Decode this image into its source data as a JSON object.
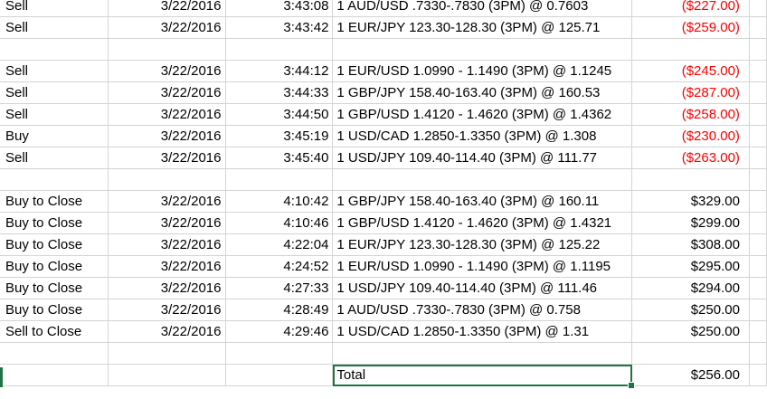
{
  "rows": [
    {
      "action": "Sell",
      "date": "3/22/2016",
      "time": "3:43:08",
      "desc": "1 AUD/USD .7330-.7830 (3PM) @ 0.7603",
      "amount": "($227.00)",
      "neg": true
    },
    {
      "action": "Sell",
      "date": "3/22/2016",
      "time": "3:43:42",
      "desc": "1 EUR/JPY 123.30-128.30 (3PM) @ 125.71",
      "amount": "($259.00)",
      "neg": true
    },
    {
      "action": "",
      "date": "",
      "time": "",
      "desc": "",
      "amount": "",
      "neg": false
    },
    {
      "action": "Sell",
      "date": "3/22/2016",
      "time": "3:44:12",
      "desc": "1 EUR/USD 1.0990 - 1.1490 (3PM) @ 1.1245",
      "amount": "($245.00)",
      "neg": true
    },
    {
      "action": "Sell",
      "date": "3/22/2016",
      "time": "3:44:33",
      "desc": "1 GBP/JPY 158.40-163.40 (3PM) @ 160.53",
      "amount": "($287.00)",
      "neg": true
    },
    {
      "action": "Sell",
      "date": "3/22/2016",
      "time": "3:44:50",
      "desc": "1 GBP/USD 1.4120 - 1.4620 (3PM) @ 1.4362",
      "amount": "($258.00)",
      "neg": true
    },
    {
      "action": "Buy",
      "date": "3/22/2016",
      "time": "3:45:19",
      "desc": "1 USD/CAD 1.2850-1.3350 (3PM) @ 1.308",
      "amount": "($230.00)",
      "neg": true
    },
    {
      "action": "Sell",
      "date": "3/22/2016",
      "time": "3:45:40",
      "desc": "1 USD/JPY 109.40-114.40 (3PM) @ 111.77",
      "amount": "($263.00)",
      "neg": true
    },
    {
      "action": "",
      "date": "",
      "time": "",
      "desc": "",
      "amount": "",
      "neg": false
    },
    {
      "action": "Buy to Close",
      "date": "3/22/2016",
      "time": "4:10:42",
      "desc": "1 GBP/JPY 158.40-163.40 (3PM) @ 160.11",
      "amount": "$329.00",
      "neg": false
    },
    {
      "action": "Buy to Close",
      "date": "3/22/2016",
      "time": "4:10:46",
      "desc": "1 GBP/USD 1.4120 - 1.4620 (3PM) @ 1.4321",
      "amount": "$299.00",
      "neg": false
    },
    {
      "action": "Buy to Close",
      "date": "3/22/2016",
      "time": "4:22:04",
      "desc": "1 EUR/JPY 123.30-128.30 (3PM) @ 125.22",
      "amount": "$308.00",
      "neg": false
    },
    {
      "action": "Buy to Close",
      "date": "3/22/2016",
      "time": "4:24:52",
      "desc": "1 EUR/USD 1.0990 - 1.1490 (3PM) @ 1.1195",
      "amount": "$295.00",
      "neg": false
    },
    {
      "action": "Buy to Close",
      "date": "3/22/2016",
      "time": "4:27:33",
      "desc": "1 USD/JPY 109.40-114.40 (3PM) @ 111.46",
      "amount": "$294.00",
      "neg": false
    },
    {
      "action": "Buy to Close",
      "date": "3/22/2016",
      "time": "4:28:49",
      "desc": "1 AUD/USD .7330-.7830 (3PM) @ 0.758",
      "amount": "$250.00",
      "neg": false
    },
    {
      "action": "Sell to Close",
      "date": "3/22/2016",
      "time": "4:29:46",
      "desc": "1 USD/CAD 1.2850-1.3350 (3PM) @ 1.31",
      "amount": "$250.00",
      "neg": false
    },
    {
      "action": "",
      "date": "",
      "time": "",
      "desc": "",
      "amount": "",
      "neg": false
    }
  ],
  "total": {
    "label": "Total",
    "amount": "$256.00"
  },
  "colors": {
    "negative": "#ff0000",
    "selection": "#217346",
    "gridline": "#d4d4d4"
  }
}
